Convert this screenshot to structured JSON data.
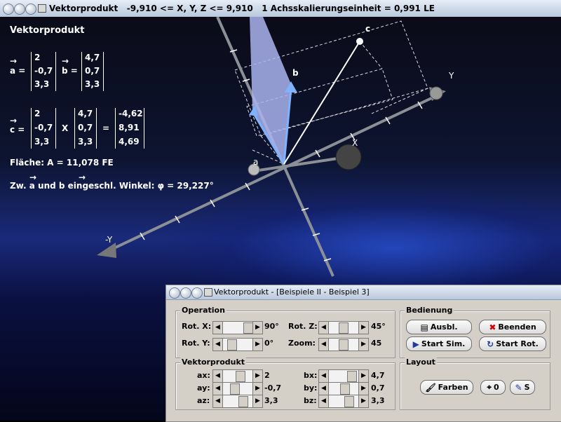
{
  "main_window": {
    "title": "Vektorprodukt   -9,910 <= X, Y, Z <= 9,910   1 Achsskalierungseinheit = 0,991 LE"
  },
  "overlay": {
    "heading": "Vektorprodukt",
    "arrow": "→",
    "vec_a_label": "a =",
    "vec_b_label": "b =",
    "vec_c_label": "c =",
    "cross_sign": "X",
    "equals_sign": "=",
    "a": [
      "2",
      "-0,7",
      "3,3"
    ],
    "b": [
      "4,7",
      "0,7",
      "3,3"
    ],
    "c": [
      "-4,62",
      "8,91",
      "4,69"
    ],
    "area_text": "Fläche: A = 11,078 FE",
    "angle_text": "Zw. a und b eingeschl. Winkel: φ = 29,227°"
  },
  "scene_labels": {
    "y_pos": "Y",
    "y_neg": "-Y",
    "x_pos": "X",
    "vec_a": "a",
    "vec_b": "b",
    "vec_c": "c"
  },
  "colors": {
    "plane": "#aab4ee",
    "vector_a": "#7fb2ff",
    "vector_b": "#7fb2ff",
    "vector_c": "#ffffff",
    "axis": "#8b8f96"
  },
  "control_window": {
    "title": "Vektorprodukt - [Beispiele II - Beispiel 3]",
    "operation": {
      "title": "Operation",
      "rot_x_label": "Rot. X:",
      "rot_x_value": "90°",
      "rot_y_label": "Rot. Y:",
      "rot_y_value": "0°",
      "rot_z_label": "Rot. Z:",
      "rot_z_value": "45°",
      "zoom_label": "Zoom:",
      "zoom_value": "45"
    },
    "bedienung": {
      "title": "Bedienung",
      "ausbl": "Ausbl.",
      "beenden": "Beenden",
      "start_sim": "Start Sim.",
      "start_rot": "Start Rot."
    },
    "vektorprodukt": {
      "title": "Vektorprodukt",
      "ax_label": "ax:",
      "ax_value": "2",
      "ay_label": "ay:",
      "ay_value": "-0,7",
      "az_label": "az:",
      "az_value": "3,3",
      "bx_label": "bx:",
      "bx_value": "4,7",
      "by_label": "by:",
      "by_value": "0,7",
      "bz_label": "bz:",
      "bz_value": "3,3"
    },
    "layout": {
      "title": "Layout",
      "farben": "Farben",
      "zero": "0",
      "s": "S"
    }
  }
}
